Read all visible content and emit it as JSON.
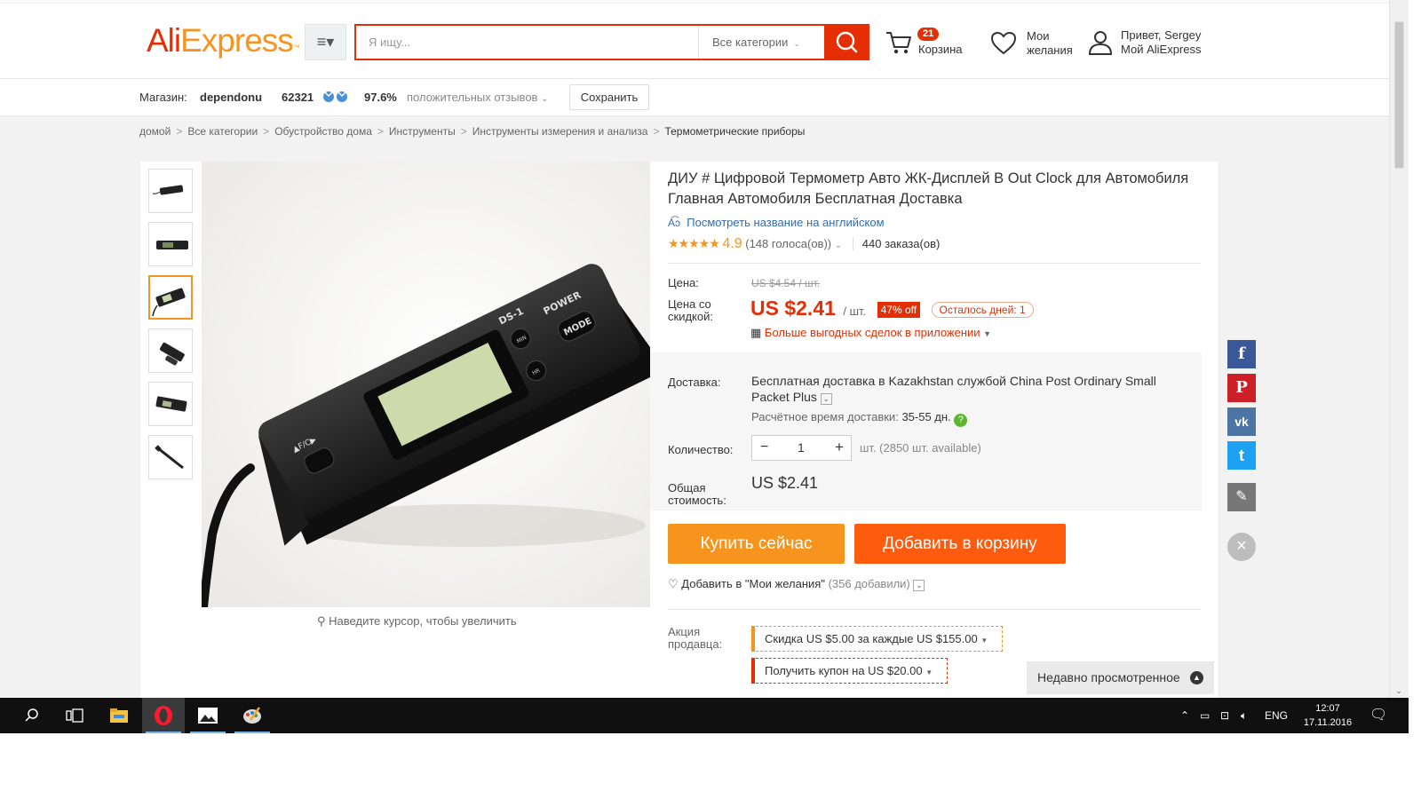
{
  "header": {
    "logo_part1": "Ali",
    "logo_part2": "Express",
    "logo_mark": "™",
    "menu_icon": "≡▾",
    "search_placeholder": "Я ищу...",
    "category_select": "Все категории",
    "cart_count": "21",
    "cart_label": "Корзина",
    "wishlist_line1": "Мои",
    "wishlist_line2": "желания",
    "account_greeting": "Привет, Sergey",
    "account_link": "Мой AliExpress"
  },
  "store": {
    "label": "Магазин:",
    "name": "dependonu",
    "score": "62321",
    "positive_pct": "97.6%",
    "positive_label": "положительных отзывов",
    "save_button": "Сохранить"
  },
  "breadcrumb": [
    "домой",
    "Все категории",
    "Обустройство дома",
    "Инструменты",
    "Инструменты измерения и анализа",
    "Термометрические приборы"
  ],
  "gallery": {
    "thumbnail_count": 6,
    "active_thumbnail": 3,
    "zoom_hint": "Наведите курсор, чтобы увеличить",
    "device_labels": {
      "model": "DS-1",
      "power": "POWER",
      "mode": "MODE",
      "unit": "▲F/C▶",
      "btn1": "MIN",
      "btn2": "HR"
    }
  },
  "product": {
    "title": "ДИУ # Цифровой Термометр Авто ЖК-Дисплей В Out Clock для Автомобиля Главная Автомобиля Бесплатная Доставка",
    "translate_link": "Посмотреть название на английском",
    "stars": "★★★★★",
    "rating": "4.9",
    "votes": "(148 голоса(ов))",
    "orders": "440 заказа(ов)",
    "price_label": "Цена:",
    "old_price": "US $4.54 / шт.",
    "discount_price_label_1": "Цена со",
    "discount_price_label_2": "скидкой:",
    "price": "US $2.41",
    "price_unit": "/ шт.",
    "discount_badge": "47% off",
    "days_left": "Осталось дней: 1",
    "app_deal": "Больше выгодных сделок в приложении",
    "shipping_label": "Доставка:",
    "shipping_text_1": "Бесплатная доставка",
    "shipping_text_2": " в Kazakhstan службой China Post Ordinary Small Packet Plus",
    "eta_label": "Расчётное время доставки:",
    "eta_value": "35-55 дн.",
    "quantity_label": "Количество:",
    "quantity_value": "1",
    "availability": "шт. (2850 шт. available)",
    "total_label_1": "Общая",
    "total_label_2": "стоимость:",
    "total": "US $2.41",
    "buy_now": "Купить сейчас",
    "add_to_cart": "Добавить в корзину",
    "wishlist_add": "Добавить в \"Мои желания\"",
    "wishlist_count": "(356 добавили)",
    "promo_label_1": "Акция",
    "promo_label_2": "продавца:",
    "promo1_a": "Скидка ",
    "promo1_b": "US $5.00",
    "promo1_c": " за каждые ",
    "promo1_d": "US $155.00",
    "promo2_a": "Получить купон на ",
    "promo2_b": "US $20.00"
  },
  "social": {
    "facebook": "f",
    "pinterest": "P",
    "vk": "vk",
    "twitter": "t",
    "edit": "✎",
    "close": "×"
  },
  "recently_viewed": "Недавно просмотренное",
  "taskbar": {
    "language": "ENG",
    "time": "12:07",
    "date": "17.11.2016",
    "colors": {
      "opera": "#ff1b2d",
      "explorer": "#f5c542",
      "accent": "#76b9ed"
    }
  },
  "colors": {
    "brand_red": "#e62e04",
    "brand_orange": "#f7941d",
    "link": "#2f6bb5"
  }
}
